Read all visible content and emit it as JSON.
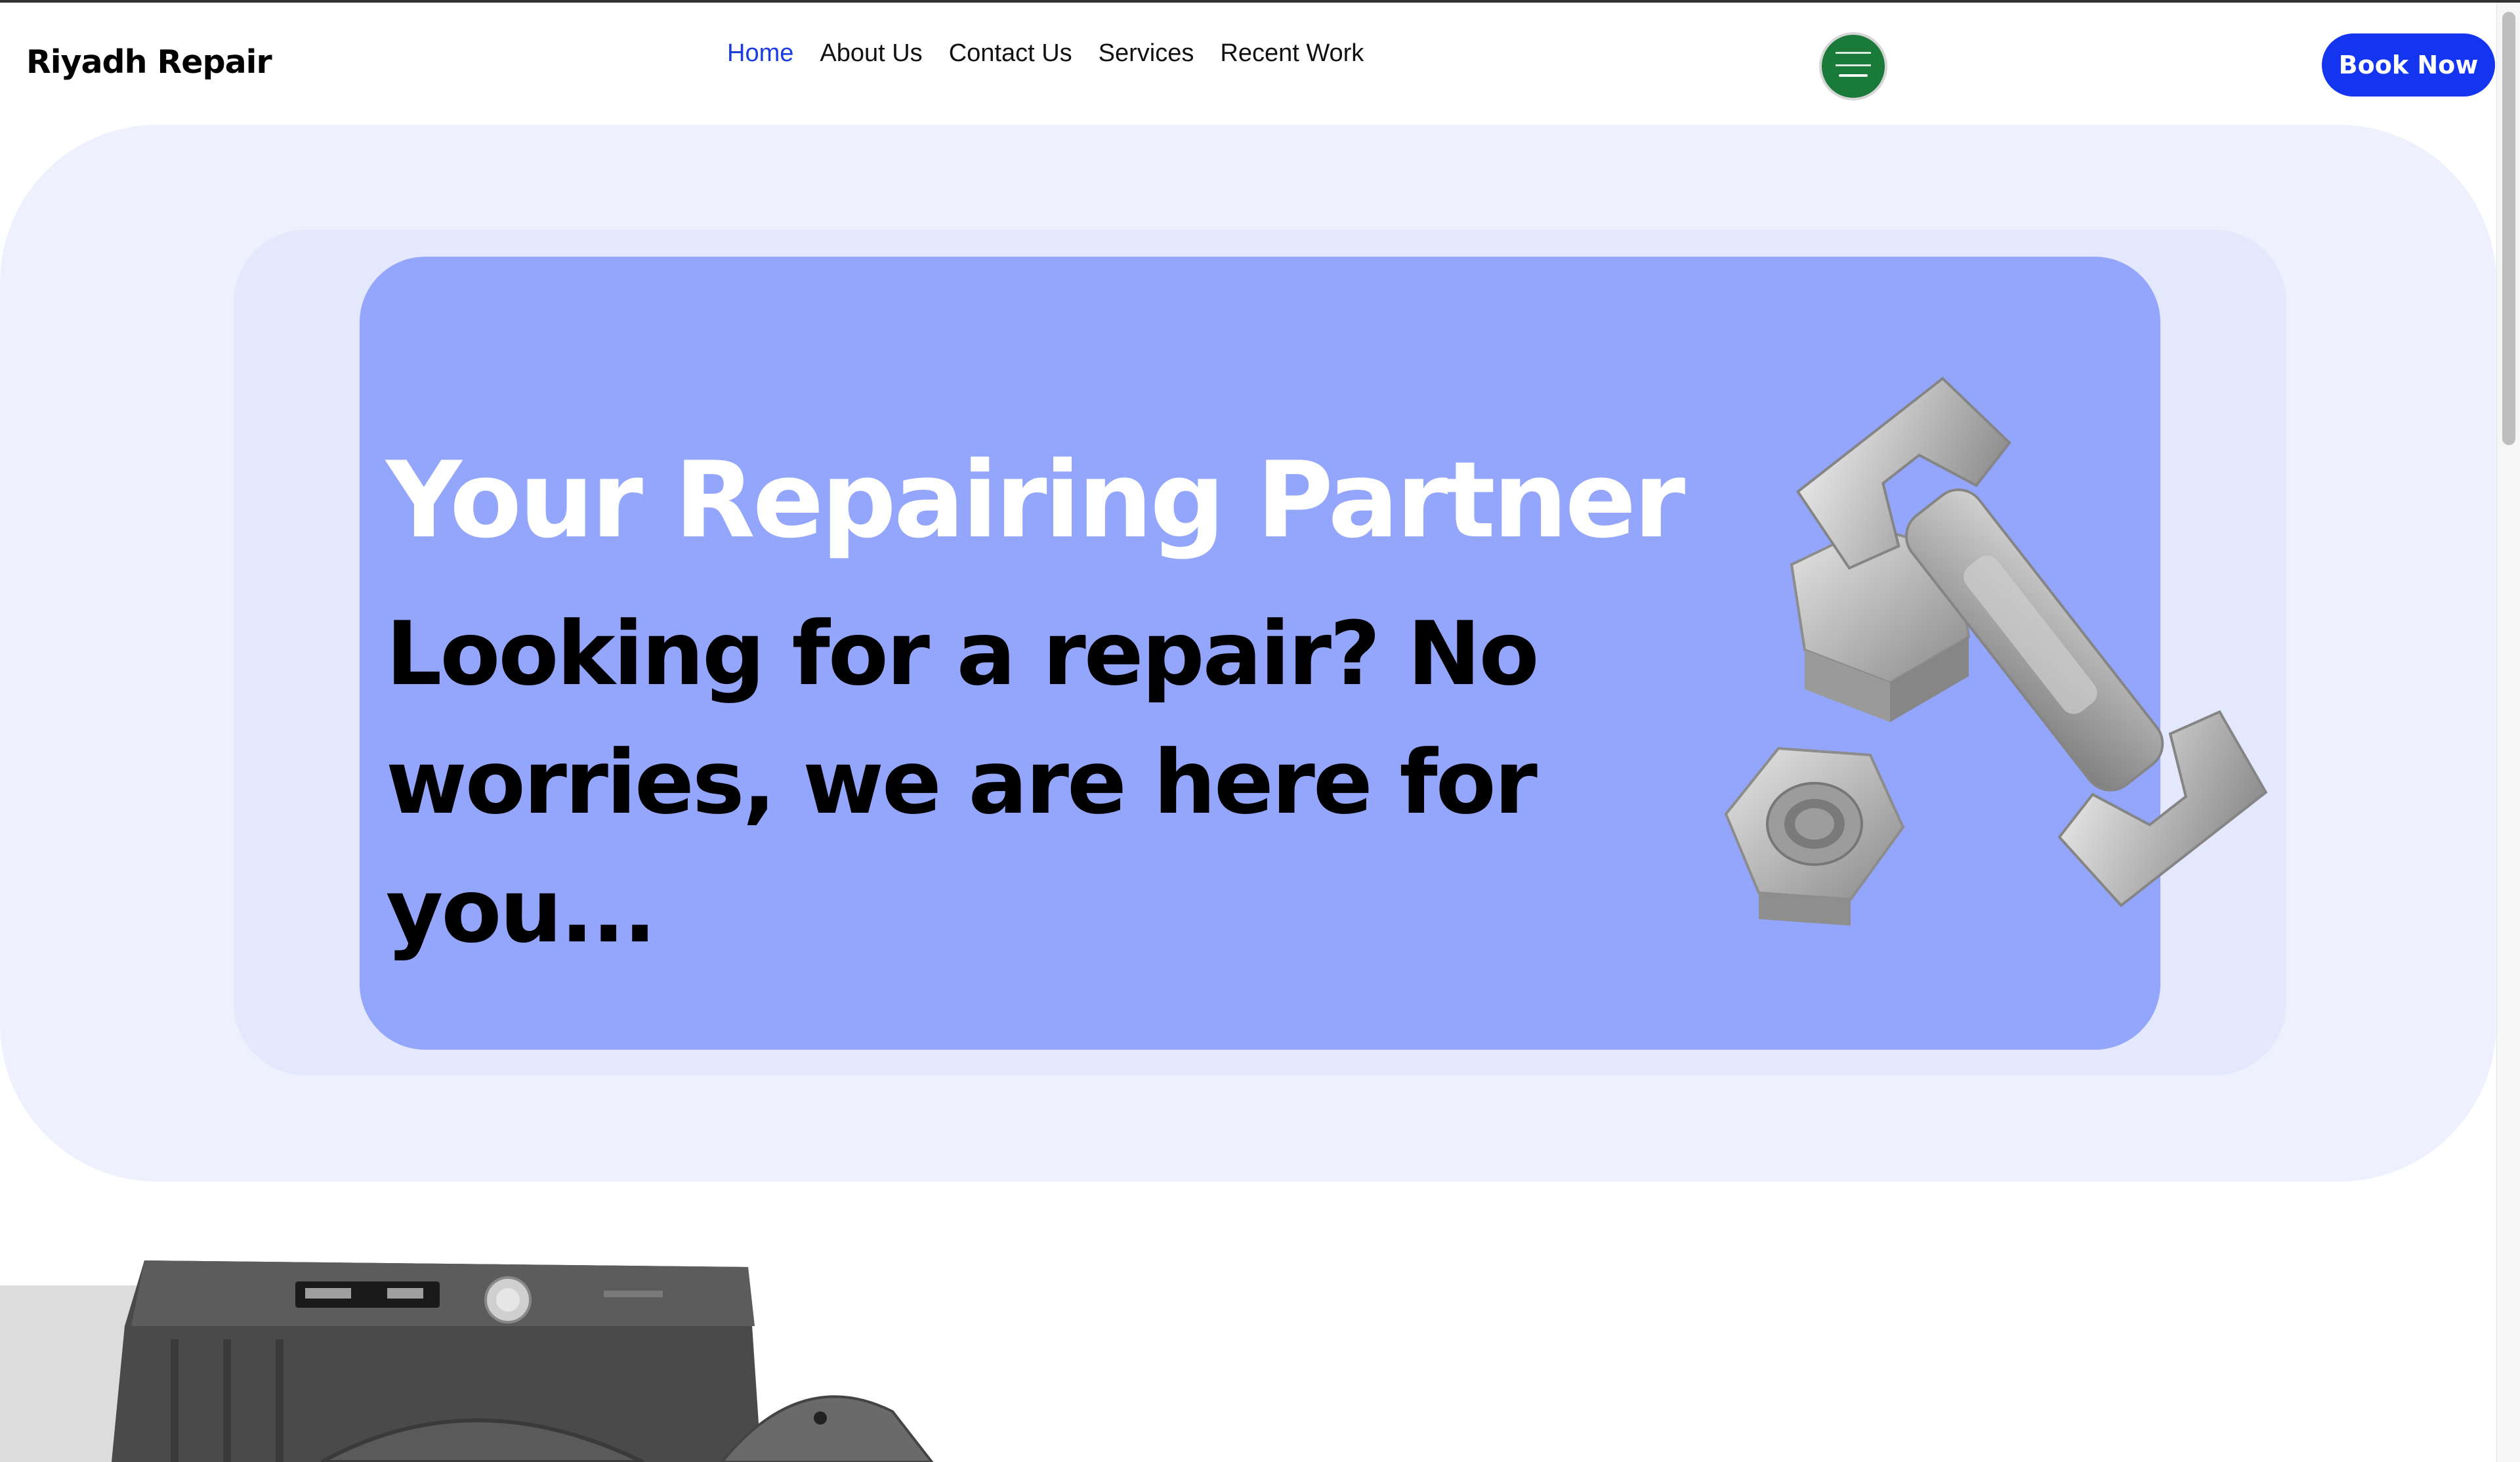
{
  "brand": {
    "name": "Riyadh Repair"
  },
  "nav": {
    "items": [
      {
        "label": "Home",
        "active": true
      },
      {
        "label": "About Us",
        "active": false
      },
      {
        "label": "Contact Us",
        "active": false
      },
      {
        "label": "Services",
        "active": false
      },
      {
        "label": "Recent Work",
        "active": false
      }
    ]
  },
  "header": {
    "language_icon": "saudi-flag-icon",
    "book_label": "Book Now"
  },
  "hero": {
    "title": "Your Repairing Partner",
    "subtitle": "Looking for a repair? No worries, we are here for you...",
    "image": "wrench-and-nuts-illustration"
  },
  "colors": {
    "accent": "#1435f0",
    "nav_active": "#1a3ce0",
    "hero_card": "#93a6fb",
    "hero_outer": "#eef1fd",
    "hero_mid": "#e3e8fc"
  }
}
